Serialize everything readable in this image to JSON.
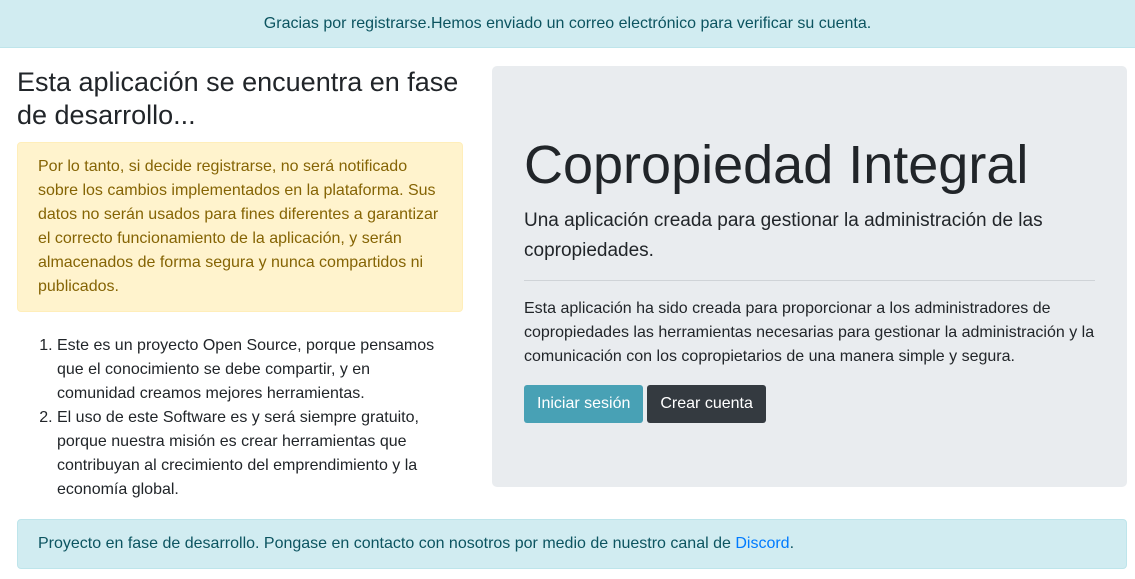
{
  "top_alert": {
    "text": "Gracias por registrarse.Hemos enviado un correo electrónico para verificar su cuenta."
  },
  "left": {
    "title": "Esta aplicación se encuentra en fase de desarrollo...",
    "warning": "Por lo tanto, si decide registrarse, no será notificado sobre los cambios implementados en la plataforma. Sus datos no serán usados para fines diferentes a garantizar el correcto funcionamiento de la aplicación, y serán almacenados de forma segura y nunca compartidos ni publicados.",
    "reasons": [
      "Este es un proyecto Open Source, porque pensamos que el conocimiento se debe compartir, y en comunidad creamos mejores herramientas.",
      "El uso de este Software es y será siempre gratuito, porque nuestra misión es crear herramientas que contribuyan al crecimiento del emprendimiento y la economía global."
    ]
  },
  "jumbotron": {
    "title": "Copropiedad Integral",
    "lead": "Una aplicación creada para gestionar la administración de las copropiedades.",
    "text": "Esta aplicación ha sido creada para proporcionar a los administradores de copropiedades las herramientas necesarias para gestionar la administración y la comunicación con los copropietarios de una manera simple y segura.",
    "login_label": "Iniciar sesión",
    "signup_label": "Crear cuenta"
  },
  "bottom_alert": {
    "text": "Proyecto en fase de desarrollo. Pongase en contacto con nosotros por medio de nuestro canal de ",
    "link_label": "Discord",
    "suffix": "."
  },
  "colors": {
    "info_bg": "#d1ecf1",
    "info_text": "#0c5460",
    "warning_bg": "#fff3cd",
    "warning_text": "#856404",
    "jumbotron_bg": "#e9ecef",
    "btn_info": "#48a1b5",
    "btn_dark": "#343a40",
    "link": "#007bff"
  }
}
